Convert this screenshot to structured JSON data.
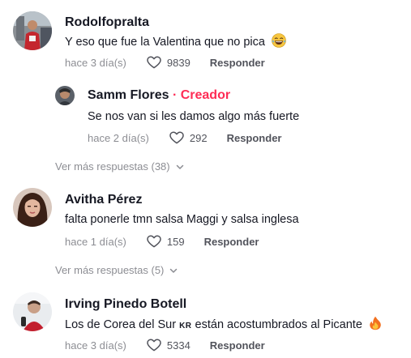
{
  "comments": [
    {
      "author": "Rodolfopralta",
      "text": "Y eso que fue la Valentina que no pica",
      "emoji": "laughing-tears-emoji",
      "time": "hace 3 día(s)",
      "likes": "9839",
      "reply_label": "Responder",
      "reply": {
        "author": "Samm Flores",
        "separator": "·",
        "badge": "Creador",
        "text": "Se nos van si les damos algo más fuerte",
        "time": "hace 2 día(s)",
        "likes": "292",
        "reply_label": "Responder"
      },
      "more_replies": "Ver más respuestas (38)"
    },
    {
      "author": "Avitha Pérez",
      "text": "falta ponerle tmn salsa Maggi y salsa inglesa",
      "time": "hace 1 día(s)",
      "likes": "159",
      "reply_label": "Responder",
      "more_replies": "Ver más respuestas (5)"
    },
    {
      "author": "Irving Pinedo Botell",
      "text_before": "Los de Corea del Sur",
      "flag_text": "KR",
      "text_after": "están acostumbrados al Picante",
      "emoji": "fire-emoji",
      "time": "hace 3 día(s)",
      "likes": "5334",
      "reply_label": "Responder"
    }
  ],
  "colors": {
    "text": "#161823",
    "creator": "#fe2c55",
    "muted": "rgba(22,24,35,0.5)"
  }
}
